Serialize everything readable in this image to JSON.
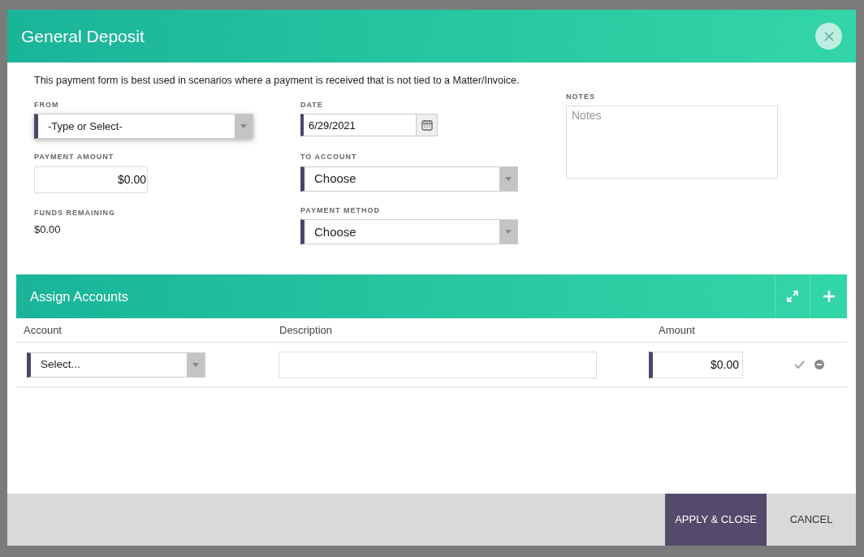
{
  "dialog": {
    "title": "General Deposit",
    "intro": "This payment form is best used in scenarios where a payment is received that is not tied to a Matter/Invoice."
  },
  "form": {
    "from": {
      "label": "FROM",
      "value": "-Type or Select-"
    },
    "payment_amount": {
      "label": "PAYMENT AMOUNT",
      "value": "$0.00"
    },
    "funds_remaining": {
      "label": "FUNDS REMAINING",
      "value": "$0.00"
    },
    "date": {
      "label": "DATE",
      "value": "6/29/2021"
    },
    "to_account": {
      "label": "TO ACCOUNT",
      "value": "Choose"
    },
    "payment_method": {
      "label": "PAYMENT METHOD",
      "value": "Choose"
    },
    "notes": {
      "label": "NOTES",
      "placeholder": "Notes"
    }
  },
  "assign_accounts": {
    "title": "Assign Accounts",
    "columns": [
      "Account",
      "Description",
      "Amount"
    ],
    "rows": [
      {
        "account": "Select...",
        "amount": "$0.00"
      }
    ]
  },
  "buttons": [
    {
      "label": "APPLY & CLOSE",
      "kind": "primary"
    },
    {
      "label": "CANCEL",
      "kind": "secondary"
    }
  ]
}
